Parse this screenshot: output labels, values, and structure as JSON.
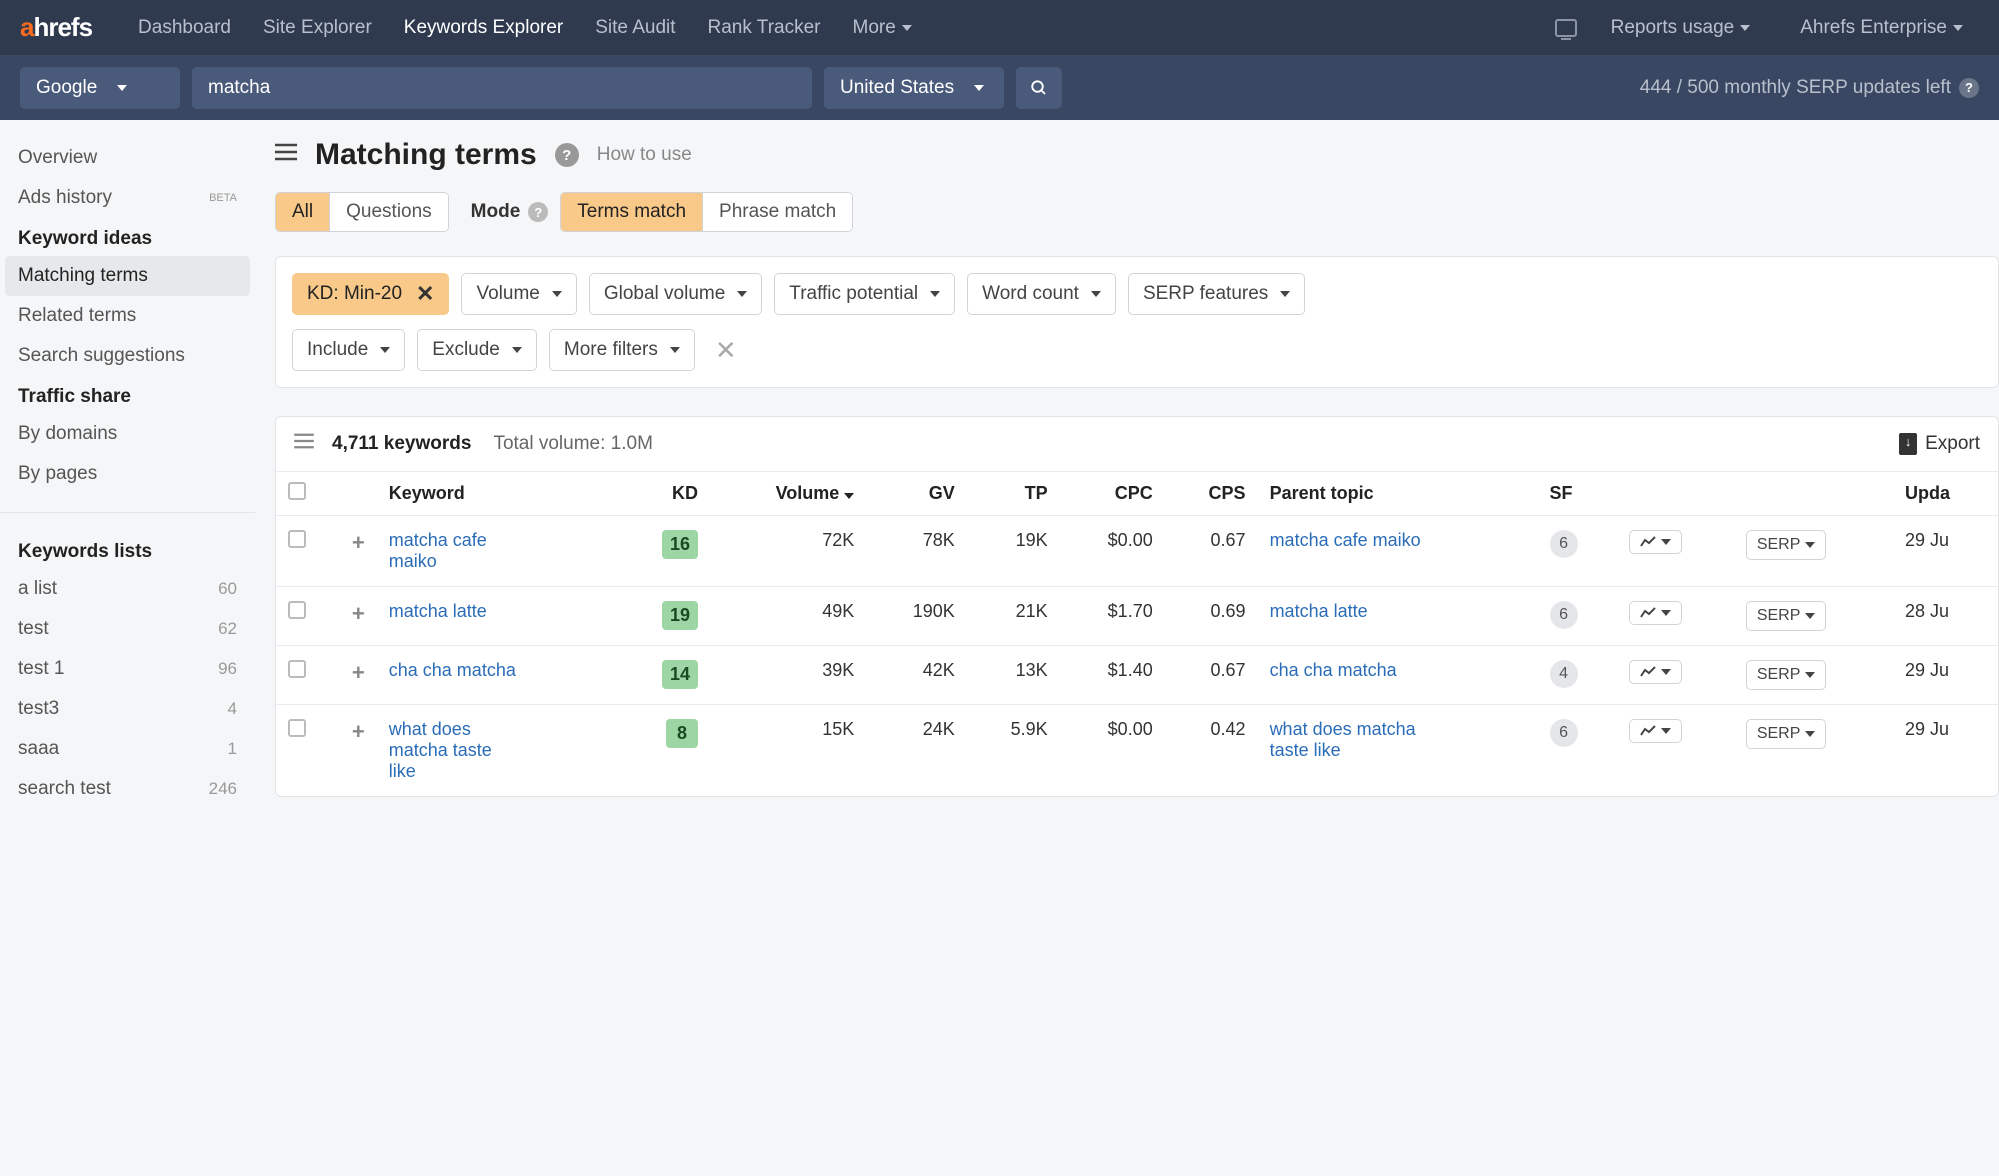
{
  "nav": {
    "items": [
      "Dashboard",
      "Site Explorer",
      "Keywords Explorer",
      "Site Audit",
      "Rank Tracker",
      "More"
    ],
    "active": "Keywords Explorer",
    "right": {
      "reports": "Reports usage",
      "plan": "Ahrefs Enterprise"
    }
  },
  "search": {
    "engine": "Google",
    "query": "matcha",
    "country": "United States",
    "updates": "444 / 500 monthly SERP updates left"
  },
  "sidebar": {
    "top": [
      "Overview",
      "Ads history"
    ],
    "ideas_header": "Keyword ideas",
    "ideas": [
      "Matching terms",
      "Related terms",
      "Search suggestions"
    ],
    "ideas_active": "Matching terms",
    "traffic_header": "Traffic share",
    "traffic": [
      "By domains",
      "By pages"
    ],
    "lists_header": "Keywords lists",
    "lists": [
      {
        "name": "a list",
        "count": 60
      },
      {
        "name": "test",
        "count": 62
      },
      {
        "name": "test 1",
        "count": 96
      },
      {
        "name": "test3",
        "count": 4
      },
      {
        "name": "saaa",
        "count": 1
      },
      {
        "name": "search test",
        "count": 246
      }
    ]
  },
  "page": {
    "title": "Matching terms",
    "how_to": "How to use",
    "mode_label": "Mode",
    "tabs1": [
      "All",
      "Questions"
    ],
    "tabs1_active": "All",
    "tabs2": [
      "Terms match",
      "Phrase match"
    ],
    "tabs2_active": "Terms match"
  },
  "filters": {
    "row1": [
      {
        "label": "KD: Min-20",
        "active": true,
        "close": true
      },
      {
        "label": "Volume"
      },
      {
        "label": "Global volume"
      },
      {
        "label": "Traffic potential"
      },
      {
        "label": "Word count"
      },
      {
        "label": "SERP features"
      }
    ],
    "row2": [
      {
        "label": "Include"
      },
      {
        "label": "Exclude"
      },
      {
        "label": "More filters"
      }
    ]
  },
  "results": {
    "count": "4,711 keywords",
    "total_vol": "Total volume: 1.0M",
    "export": "Export",
    "columns": [
      "Keyword",
      "KD",
      "Volume",
      "GV",
      "TP",
      "CPC",
      "CPS",
      "Parent topic",
      "SF",
      "",
      "",
      "Upda"
    ],
    "serp_label": "SERP",
    "rows": [
      {
        "keyword": "matcha cafe maiko",
        "kd": "16",
        "volume": "72K",
        "gv": "78K",
        "tp": "19K",
        "cpc": "$0.00",
        "cps": "0.67",
        "parent": "matcha cafe maiko",
        "sf": "6",
        "updated": "29 Ju"
      },
      {
        "keyword": "matcha latte",
        "kd": "19",
        "volume": "49K",
        "gv": "190K",
        "tp": "21K",
        "cpc": "$1.70",
        "cps": "0.69",
        "parent": "matcha latte",
        "sf": "6",
        "updated": "28 Ju"
      },
      {
        "keyword": "cha cha matcha",
        "kd": "14",
        "volume": "39K",
        "gv": "42K",
        "tp": "13K",
        "cpc": "$1.40",
        "cps": "0.67",
        "parent": "cha cha matcha",
        "sf": "4",
        "updated": "29 Ju"
      },
      {
        "keyword": "what does matcha taste like",
        "kd": "8",
        "volume": "15K",
        "gv": "24K",
        "tp": "5.9K",
        "cpc": "$0.00",
        "cps": "0.42",
        "parent": "what does matcha taste like",
        "sf": "6",
        "updated": "29 Ju"
      }
    ]
  }
}
